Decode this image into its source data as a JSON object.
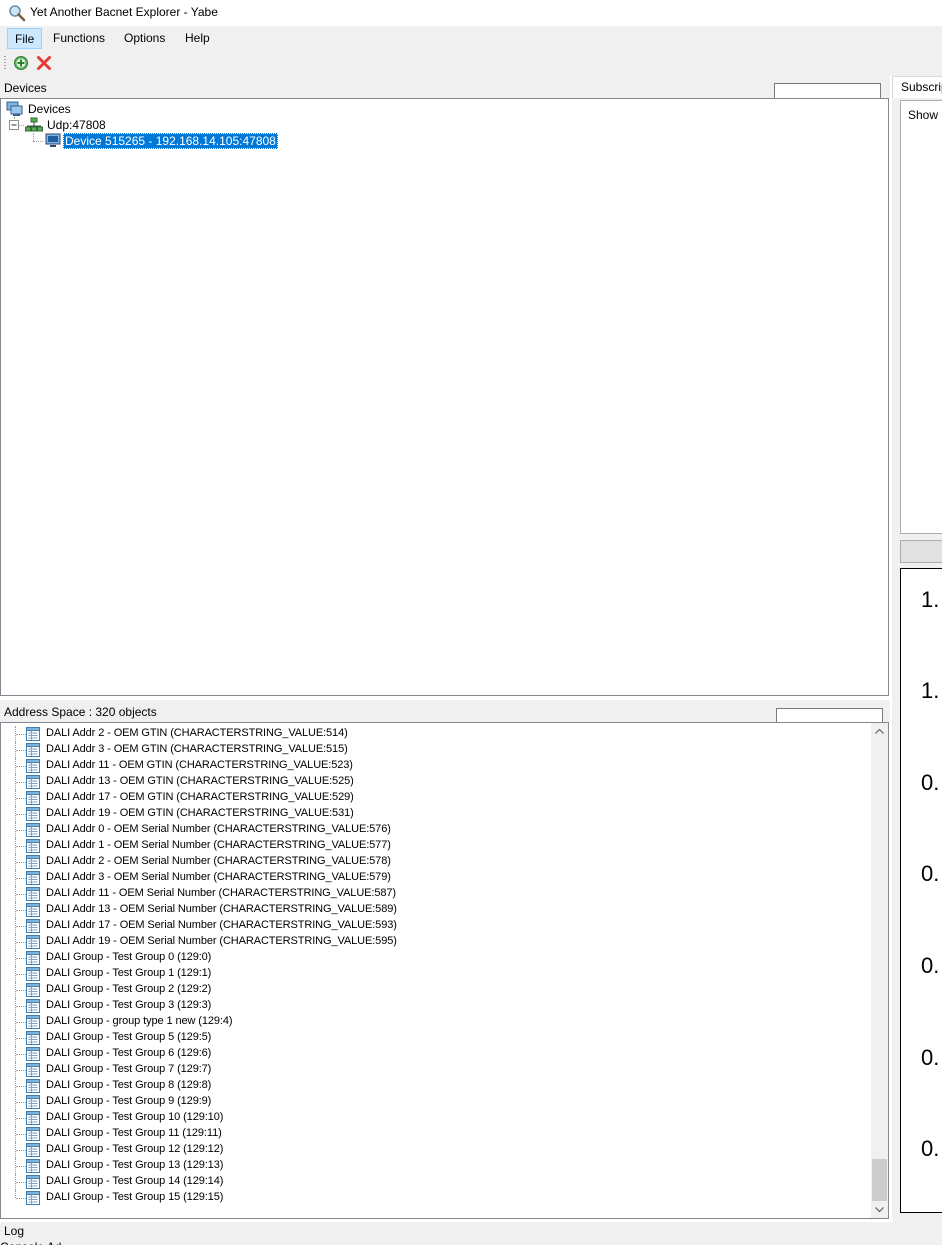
{
  "window": {
    "title": "Yet Another Bacnet Explorer - Yabe",
    "icon": "magnifier-icon"
  },
  "menu": [
    {
      "label": "File",
      "active": true
    },
    {
      "label": "Functions",
      "active": false
    },
    {
      "label": "Options",
      "active": false
    },
    {
      "label": "Help",
      "active": false
    }
  ],
  "toolbar": {
    "add_icon": "add-device-icon",
    "remove_icon": "remove-device-icon"
  },
  "devices": {
    "label": "Devices",
    "filter_value": "",
    "tree": {
      "root": "Devices",
      "transport": "Udp:47808",
      "device": "Device 515265 - 192.168.14.105:47808"
    }
  },
  "address_space": {
    "label": "Address Space : 320 objects",
    "filter_value": "",
    "items": [
      "DALI Addr 2 -  OEM GTIN (CHARACTERSTRING_VALUE:514)",
      "DALI Addr 3 -  OEM GTIN (CHARACTERSTRING_VALUE:515)",
      "DALI Addr 11 -  OEM GTIN (CHARACTERSTRING_VALUE:523)",
      "DALI Addr 13 -  OEM GTIN (CHARACTERSTRING_VALUE:525)",
      "DALI Addr 17 -  OEM GTIN (CHARACTERSTRING_VALUE:529)",
      "DALI Addr 19 -  OEM GTIN (CHARACTERSTRING_VALUE:531)",
      "DALI Addr 0 -  OEM Serial Number (CHARACTERSTRING_VALUE:576)",
      "DALI Addr 1 -  OEM Serial Number (CHARACTERSTRING_VALUE:577)",
      "DALI Addr 2 -  OEM Serial Number (CHARACTERSTRING_VALUE:578)",
      "DALI Addr 3 -  OEM Serial Number (CHARACTERSTRING_VALUE:579)",
      "DALI Addr 11 -  OEM Serial Number (CHARACTERSTRING_VALUE:587)",
      "DALI Addr 13 -  OEM Serial Number (CHARACTERSTRING_VALUE:589)",
      "DALI Addr 17 -  OEM Serial Number (CHARACTERSTRING_VALUE:593)",
      "DALI Addr 19 -  OEM Serial Number (CHARACTERSTRING_VALUE:595)",
      "DALI Group - Test Group 0 (129:0)",
      "DALI Group - Test Group 1 (129:1)",
      "DALI Group - Test Group 2 (129:2)",
      "DALI Group - Test Group 3 (129:3)",
      "DALI Group - group type 1 new (129:4)",
      "DALI Group - Test Group 5 (129:5)",
      "DALI Group - Test Group 6 (129:6)",
      "DALI Group - Test Group 7 (129:7)",
      "DALI Group - Test Group 8 (129:8)",
      "DALI Group - Test Group 9 (129:9)",
      "DALI Group - Test Group 10 (129:10)",
      "DALI Group - Test Group 11 (129:11)",
      "DALI Group - Test Group 12 (129:12)",
      "DALI Group - Test Group 13 (129:13)",
      "DALI Group - Test Group 14 (129:14)",
      "DALI Group - Test Group 15 (129:15)"
    ]
  },
  "subscriptions": {
    "tab_label": "Subscripti",
    "show_label": "Show"
  },
  "values_panel": [
    "1.",
    "1.",
    "0.",
    "0.",
    "0.",
    "0.",
    "0."
  ],
  "log": {
    "label": "Log",
    "partial_text": "Console Ad"
  },
  "colors": {
    "selection": "#0078d7",
    "menu_active": "#cce8ff",
    "chrome": "#f0f0f0"
  }
}
